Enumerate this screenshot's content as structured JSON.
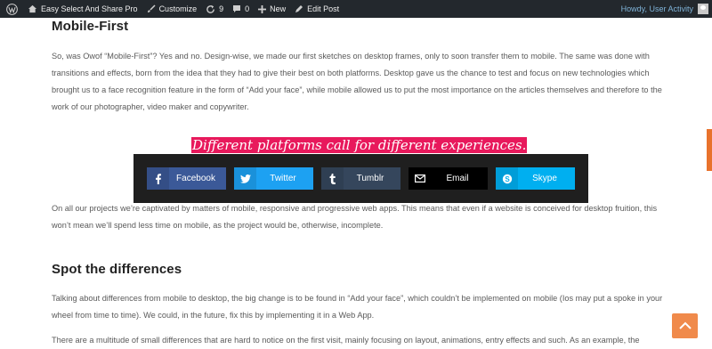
{
  "adminbar": {
    "site_name": "Easy Select And Share Pro",
    "customize_label": "Customize",
    "updates_count": "9",
    "comments_count": "0",
    "new_label": "New",
    "edit_label": "Edit Post",
    "howdy_label": "Howdy, User Activity"
  },
  "article": {
    "heading_1": "Mobile-First",
    "para_1": "So, was Owof “Mobile-First”? Yes and no. Design-wise, we made our first sketches on desktop frames, only to soon transfer them to mobile. The same was done with transitions and effects, born from the idea that they had to give their best on both platforms. Desktop gave us the chance to test and focus on new technologies which brought us to a face recognition feature in the form of “Add your face”, while mobile allowed us to put the most importance on the articles themselves and therefore to the work of our photographer, video maker and copywriter.",
    "selected_quote": "Different platforms call for different experiences.",
    "para_2": "On all our projects we’re captivated by matters of mobile, responsive and progressive web apps. This means that even if a website is conceived for desktop fruition, this won’t mean we’ll spend less time on mobile, as the project would be, otherwise, incomplete.",
    "heading_2": "Spot the differences",
    "para_3": "Talking about differences from mobile to desktop, the big change is to be found in “Add your face”, which couldn’t be implemented on mobile (Ios may put a spoke in your wheel from time to time). We could, in the future, fix this by implementing it in a Web App.",
    "para_4": "There are a multitude of small differences that are hard to notice on the first visit, mainly focusing on layout, animations, entry effects and such. As an example, the"
  },
  "share": {
    "facebook_label": "Facebook",
    "twitter_label": "Twitter",
    "tumblr_label": "Tumblr",
    "email_label": "Email",
    "skype_label": "Skype"
  },
  "colors": {
    "highlight": "#e8195c",
    "facebook": "#3b5998",
    "twitter": "#1da1f2",
    "tumblr": "#35465c",
    "email": "#000000",
    "skype": "#00aff0",
    "accent_orange": "#f08a4b"
  }
}
